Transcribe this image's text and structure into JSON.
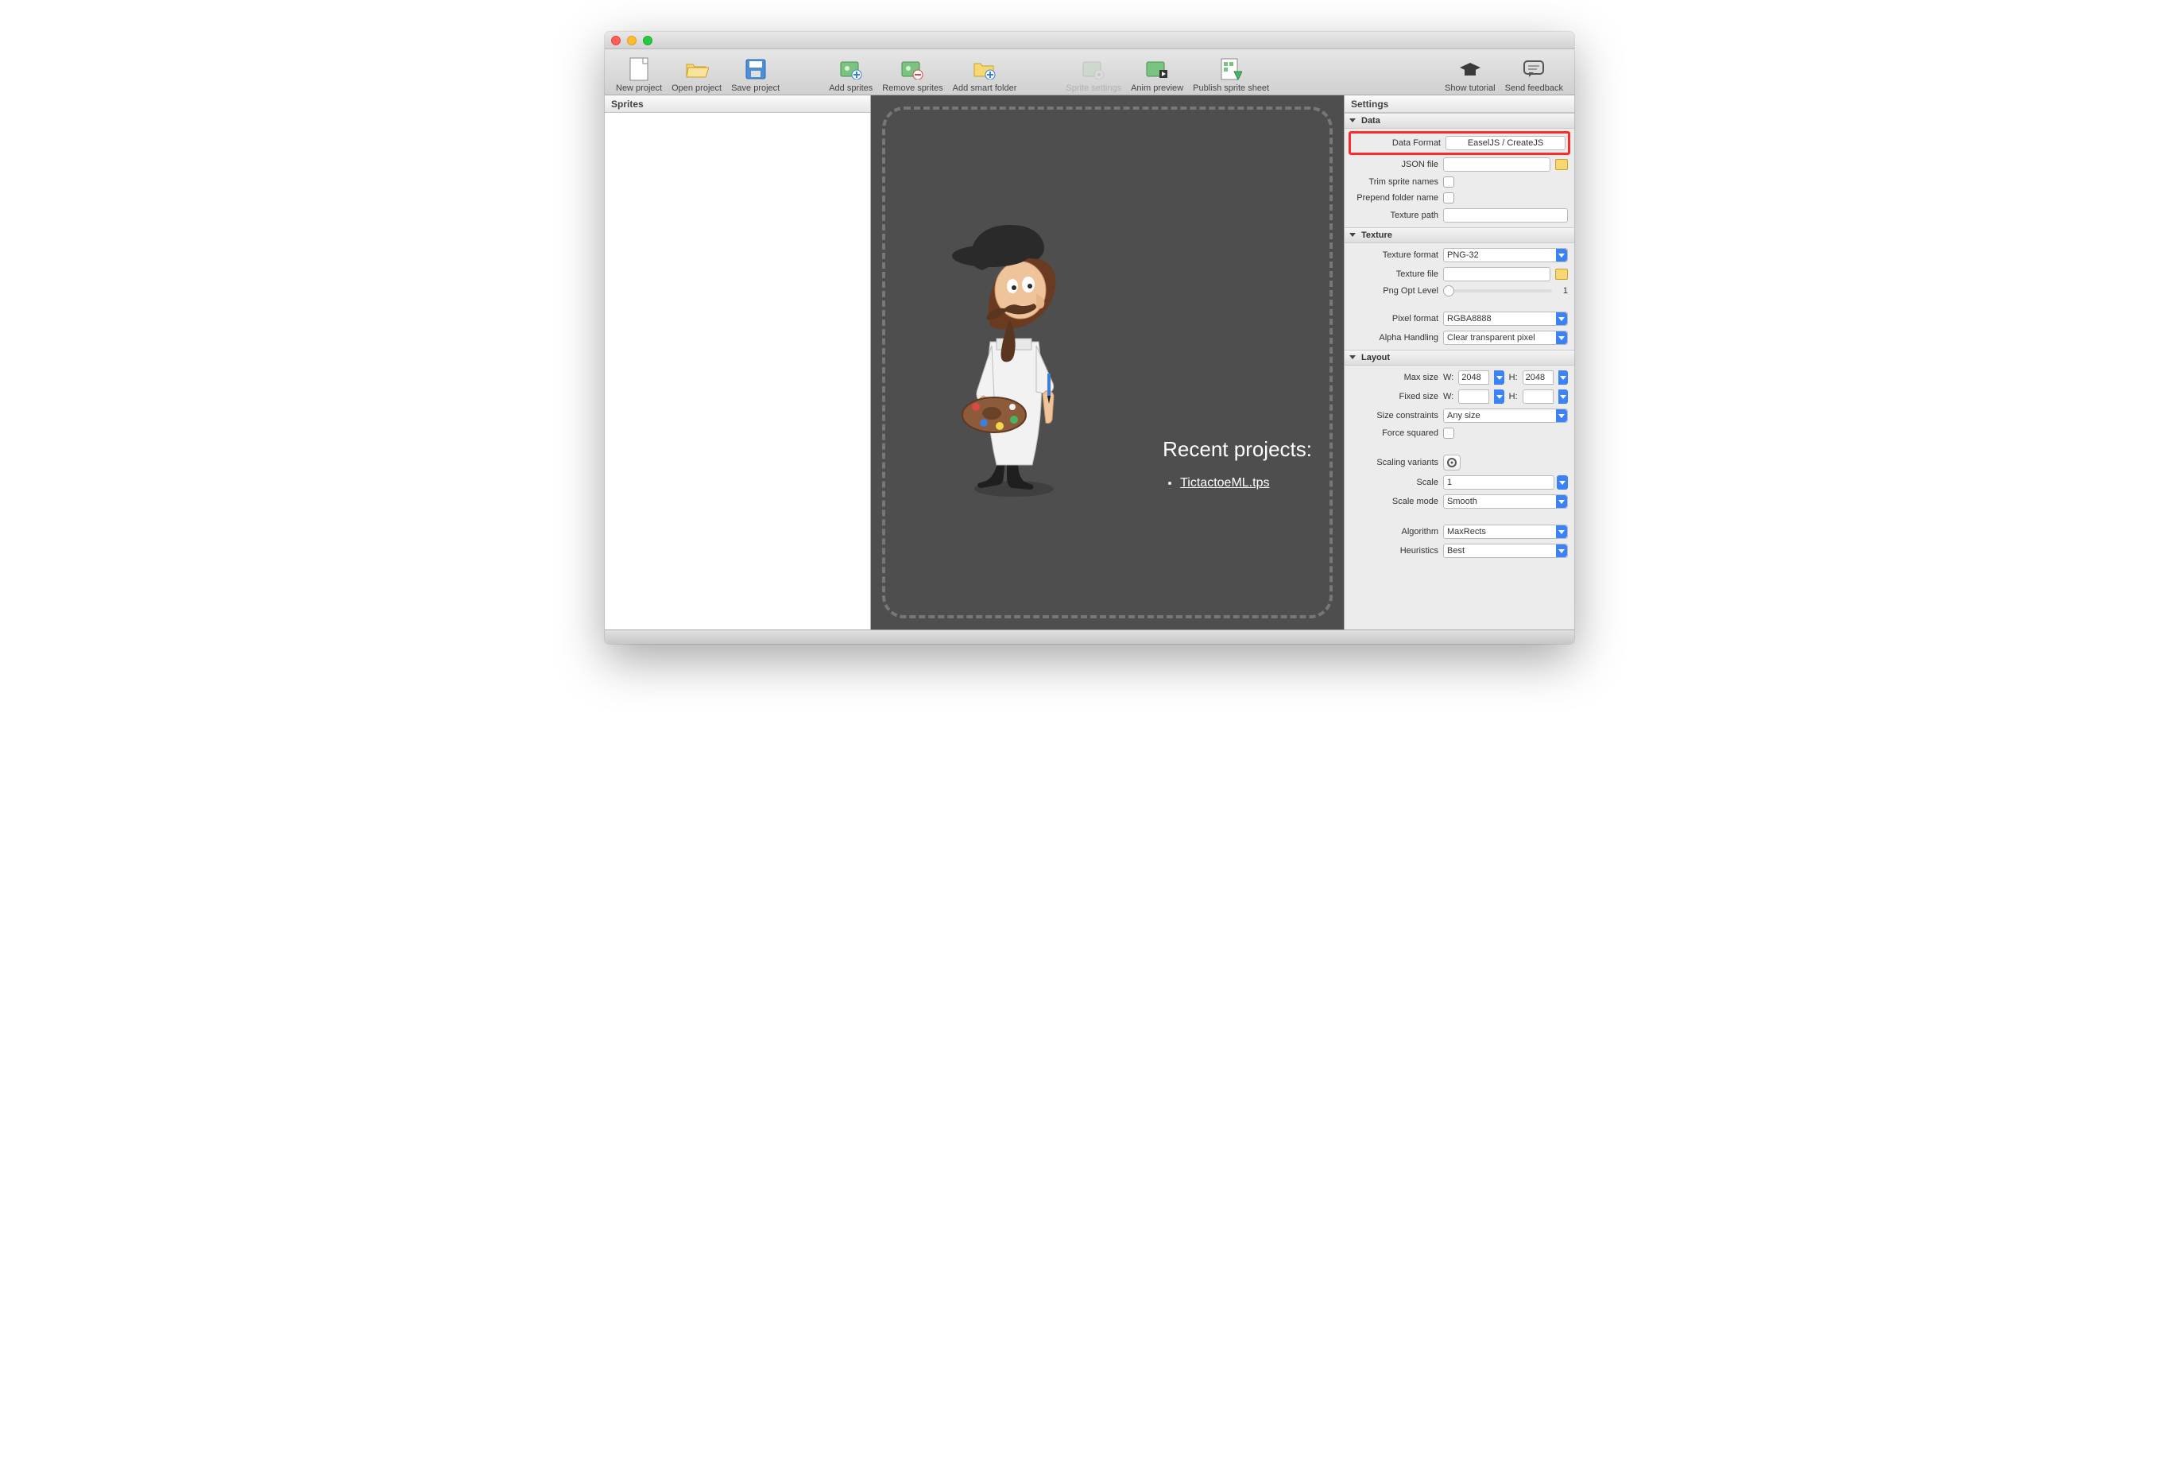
{
  "toolbar": {
    "new_project": "New project",
    "open_project": "Open project",
    "save_project": "Save project",
    "add_sprites": "Add sprites",
    "remove_sprites": "Remove sprites",
    "add_smart_folder": "Add smart folder",
    "sprite_settings": "Sprite settings",
    "anim_preview": "Anim preview",
    "publish": "Publish sprite sheet",
    "show_tutorial": "Show tutorial",
    "send_feedback": "Send feedback"
  },
  "panels": {
    "sprites": "Sprites",
    "settings": "Settings"
  },
  "canvas": {
    "recent_title": "Recent projects:",
    "recent_items": [
      "TictactoeML.tps"
    ]
  },
  "sections": {
    "data": "Data",
    "texture": "Texture",
    "layout": "Layout"
  },
  "settings": {
    "data_format": {
      "label": "Data Format",
      "value": "EaselJS / CreateJS"
    },
    "json_file": {
      "label": "JSON file",
      "value": ""
    },
    "trim_names": {
      "label": "Trim sprite names"
    },
    "prepend_folder": {
      "label": "Prepend folder name"
    },
    "texture_path": {
      "label": "Texture path",
      "value": ""
    },
    "texture_format": {
      "label": "Texture format",
      "value": "PNG-32"
    },
    "texture_file": {
      "label": "Texture file",
      "value": ""
    },
    "png_opt": {
      "label": "Png Opt Level",
      "value": "1"
    },
    "pixel_format": {
      "label": "Pixel format",
      "value": "RGBA8888"
    },
    "alpha_handling": {
      "label": "Alpha Handling",
      "value": "Clear transparent pixel"
    },
    "max_size": {
      "label": "Max size",
      "w_label": "W:",
      "w": "2048",
      "h_label": "H:",
      "h": "2048"
    },
    "fixed_size": {
      "label": "Fixed size",
      "w_label": "W:",
      "w": "",
      "h_label": "H:",
      "h": ""
    },
    "size_constraints": {
      "label": "Size constraints",
      "value": "Any size"
    },
    "force_squared": {
      "label": "Force squared"
    },
    "scaling_variants": {
      "label": "Scaling variants"
    },
    "scale": {
      "label": "Scale",
      "value": "1"
    },
    "scale_mode": {
      "label": "Scale mode",
      "value": "Smooth"
    },
    "algorithm": {
      "label": "Algorithm",
      "value": "MaxRects"
    },
    "heuristics": {
      "label": "Heuristics",
      "value": "Best"
    }
  }
}
